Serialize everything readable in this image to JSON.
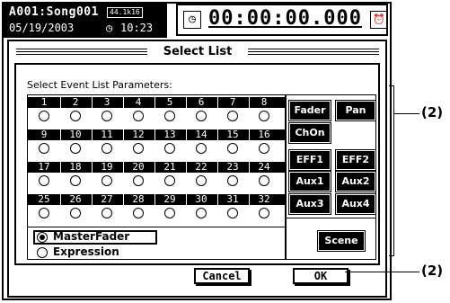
{
  "status": {
    "song": "A001:Song001",
    "sample_rate": "44.1k16",
    "date": "05/19/2003",
    "clock_icon": "clock-icon",
    "time": "10:23",
    "counter": "00:00:00.000"
  },
  "dialog": {
    "title": "Select List",
    "prompt": "Select Event List Parameters:",
    "channels": [
      "1",
      "2",
      "3",
      "4",
      "5",
      "6",
      "7",
      "8",
      "9",
      "10",
      "11",
      "12",
      "13",
      "14",
      "15",
      "16",
      "17",
      "18",
      "19",
      "20",
      "21",
      "22",
      "23",
      "24",
      "25",
      "26",
      "27",
      "28",
      "29",
      "30",
      "31",
      "32"
    ],
    "masterfader_label": "MasterFader",
    "expression_label": "Expression",
    "buttons": {
      "fader": "Fader",
      "pan": "Pan",
      "chon": "ChOn",
      "eff1": "EFF1",
      "eff2": "EFF2",
      "aux1": "Aux1",
      "aux2": "Aux2",
      "aux3": "Aux3",
      "aux4": "Aux4",
      "scene": "Scene"
    },
    "cancel": "Cancel",
    "ok": "OK"
  },
  "callouts": {
    "upper": "(2)",
    "lower": "(2)"
  }
}
